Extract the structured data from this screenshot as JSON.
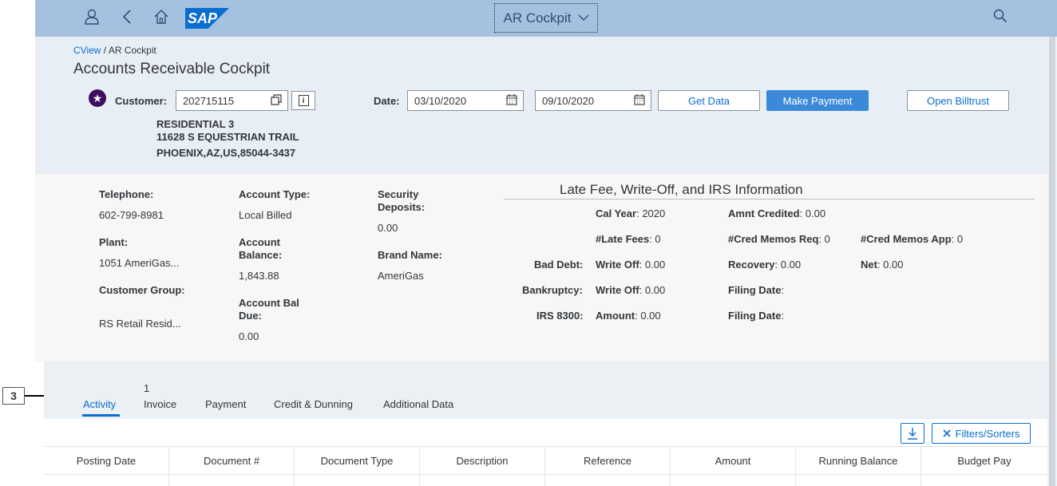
{
  "callout": {
    "label": "3"
  },
  "shell": {
    "title": "AR Cockpit",
    "logo_text": "SAP",
    "icons": [
      "user-icon",
      "back-icon",
      "home-icon",
      "search-icon"
    ]
  },
  "header": {
    "breadcrumb_link": "CView",
    "breadcrumb_sep": " / ",
    "breadcrumb_current": "AR Cockpit",
    "title": "Accounts Receivable Cockpit",
    "customer_label": "Customer:",
    "customer_value": "202715115",
    "date_label": "Date:",
    "date_from": "03/10/2020",
    "date_to": "09/10/2020",
    "get_data": "Get Data",
    "make_payment": "Make Payment",
    "open_billtrust": "Open Billtrust",
    "address": [
      "RESIDENTIAL 3",
      "11628 S EQUESTRIAN TRAIL",
      "PHOENIX,AZ,US,85044-3437"
    ]
  },
  "details": {
    "telephone_label": "Telephone:",
    "telephone": "602-799-8981",
    "plant_label": "Plant:",
    "plant": "1051 AmeriGas...",
    "customer_group_label": "Customer Group:",
    "customer_group": "RS Retail Resid...",
    "account_type_label": "Account Type:",
    "account_type": "Local Billed",
    "account_balance_label": "Account Balance:",
    "account_balance": "1,843.88",
    "account_bal_due_label": "Account Bal Due:",
    "account_bal_due": "0.00",
    "security_deposits_label": "Security Deposits:",
    "security_deposits": "0.00",
    "brand_name_label": "Brand Name:",
    "brand_name": "AmeriGas"
  },
  "late_fee": {
    "title": "Late Fee, Write-Off, and IRS Information",
    "cal_year_label": "Cal Year",
    "cal_year": ": 2020",
    "amnt_credited_label": "Amnt Credited",
    "amnt_credited": ": 0.00",
    "late_fees_label": "#Late Fees",
    "late_fees": ": 0",
    "cred_memos_req_label": "#Cred Memos Req",
    "cred_memos_req": ": 0",
    "cred_memos_app_label": "#Cred Memos App",
    "cred_memos_app": ": 0",
    "bad_debt_label": "Bad Debt:",
    "write_off_label": "Write Off",
    "bad_debt_write_off": ": 0.00",
    "recovery_label": "Recovery",
    "recovery": ": 0.00",
    "net_label": "Net",
    "net": ": 0.00",
    "bankruptcy_label": "Bankruptcy:",
    "bankruptcy_write_off": ": 0.00",
    "filing_date_label": "Filing Date",
    "filing_date_suffix": ":",
    "irs_label": "IRS 8300:",
    "amount_label": "Amount",
    "amount": ": 0.00"
  },
  "tabs": {
    "invoice_count": "1",
    "items": [
      "Activity",
      "Invoice",
      "Payment",
      "Credit & Dunning",
      "Additional Data"
    ]
  },
  "table": {
    "filters_label": "Filters/Sorters",
    "columns": [
      "Posting Date",
      "Document #",
      "Document Type",
      "Description",
      "Reference",
      "Amount",
      "Running Balance",
      "Budget Pay"
    ]
  }
}
